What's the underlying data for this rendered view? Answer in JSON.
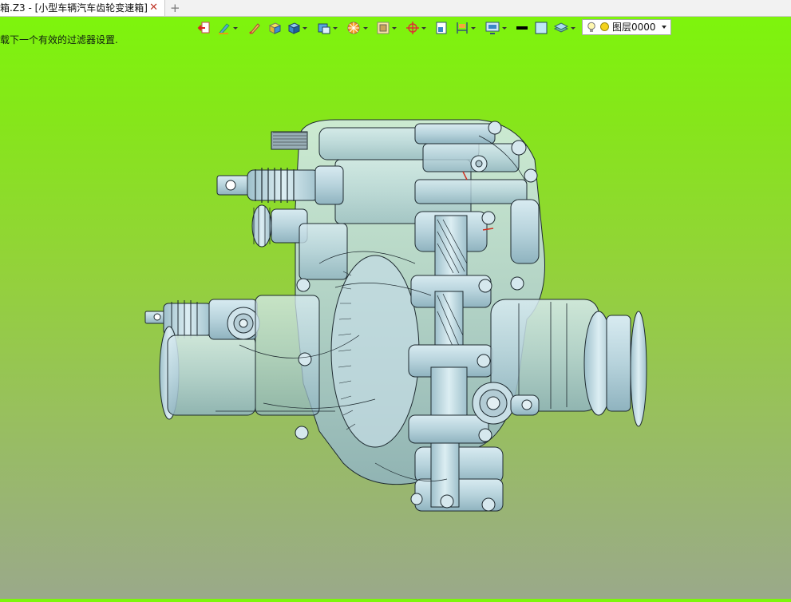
{
  "window": {
    "tab_title": "箱.Z3 - [小型车辆汽车齿轮变速箱]",
    "close_glyph": "✕",
    "new_tab_glyph": "+"
  },
  "prompt": {
    "text": "载下一个有效的过滤器设置."
  },
  "toolbar": {
    "icons": [
      "exit-icon",
      "pen-icon",
      "pencil-icon",
      "solid-box-icon",
      "cube-icon",
      "view-cube-icon",
      "render-icon",
      "shade-icon",
      "snap-icon",
      "page-icon",
      "dimension-icon",
      "display-icon",
      "line-color-icon",
      "fill-color-icon",
      "layer-stack-icon"
    ],
    "layer_selector": {
      "value": "图层0000",
      "bulb_icon": "lightbulb-icon",
      "color_icon": "layer-color-icon"
    }
  },
  "viewport": {
    "model": "gearbox-assembly",
    "background_top": "#7cf70a",
    "background_bottom": "#9aa98a",
    "model_color": "#b8d4dc",
    "edge_color": "#1e2a30"
  }
}
